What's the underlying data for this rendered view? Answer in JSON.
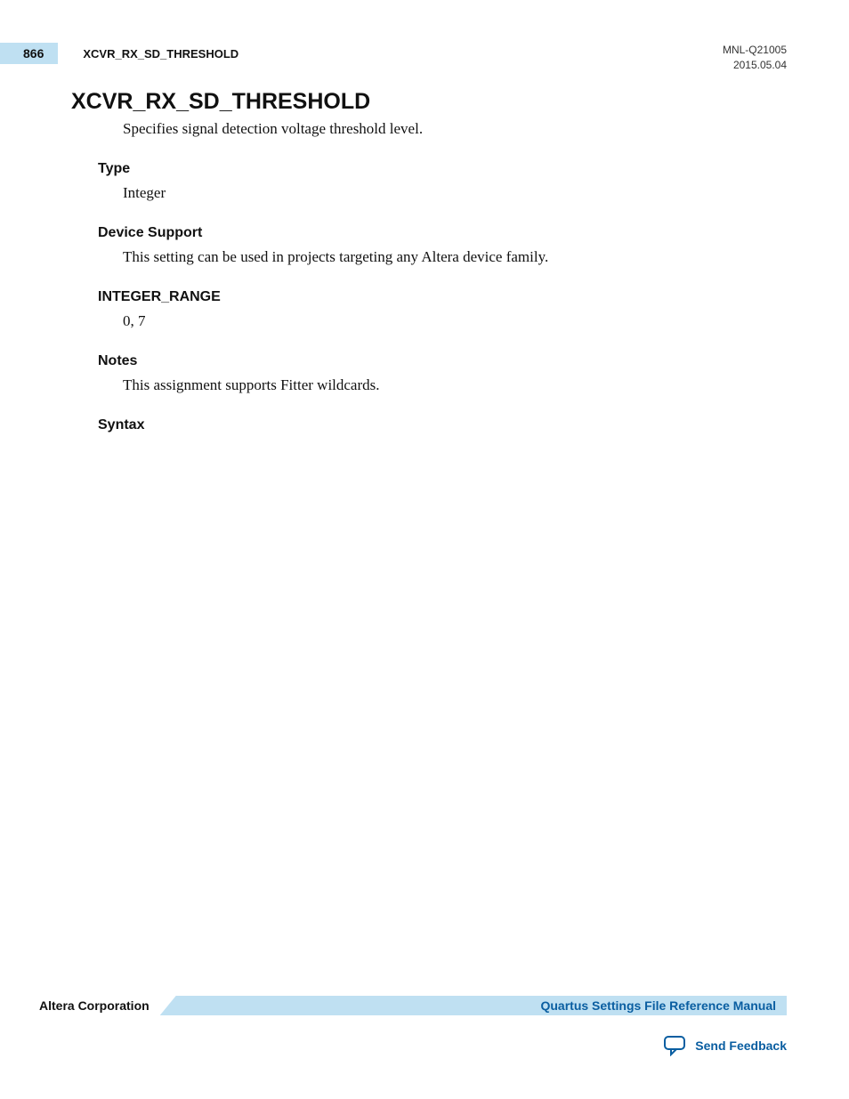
{
  "header": {
    "page_number": "866",
    "running_title": "XCVR_RX_SD_THRESHOLD",
    "doc_id": "MNL-Q21005",
    "date": "2015.05.04"
  },
  "title": "XCVR_RX_SD_THRESHOLD",
  "description": "Specifies signal detection voltage threshold level.",
  "sections": {
    "type_heading": "Type",
    "type_body": "Integer",
    "device_heading": "Device Support",
    "device_body": "This setting can be used in projects targeting any Altera device family.",
    "range_heading": "INTEGER_RANGE",
    "range_body": "0, 7",
    "notes_heading": "Notes",
    "notes_body": "This assignment supports Fitter wildcards.",
    "syntax_heading": "Syntax"
  },
  "footer": {
    "company": "Altera Corporation",
    "manual_link": "Quartus Settings File Reference Manual",
    "feedback": "Send Feedback"
  }
}
